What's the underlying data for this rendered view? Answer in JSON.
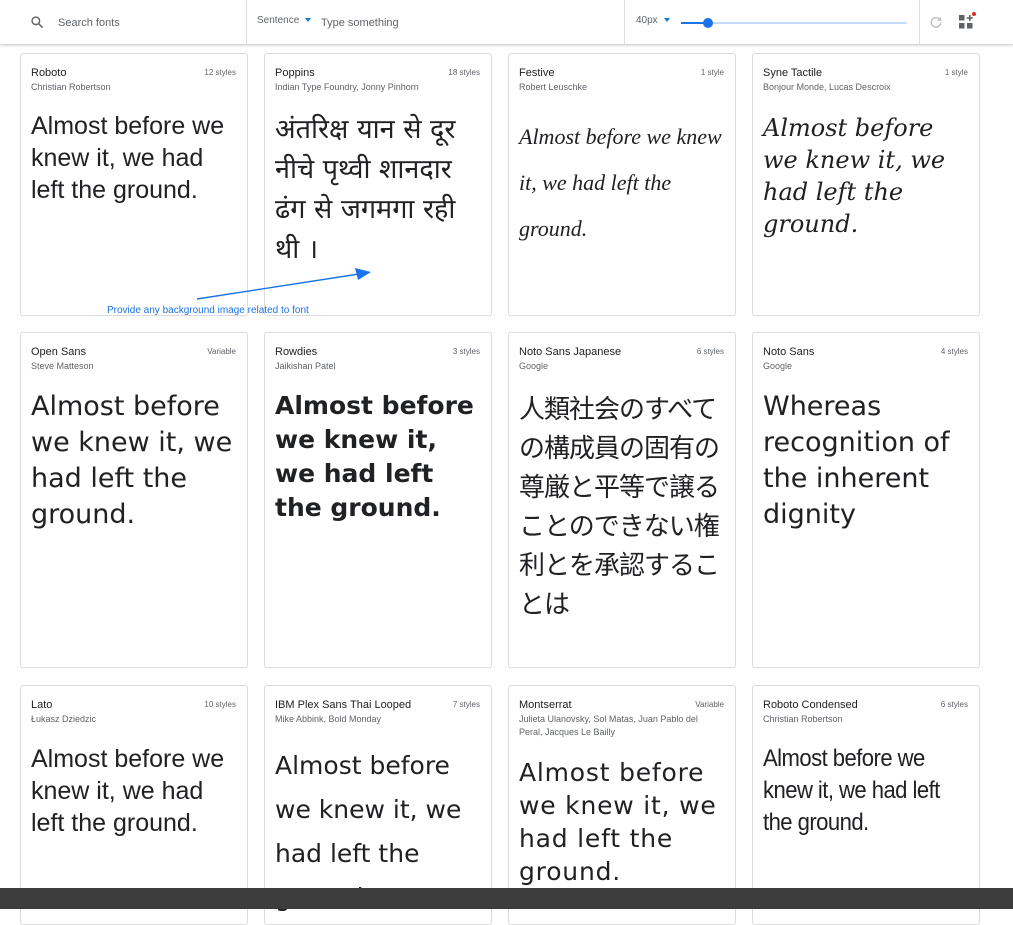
{
  "toolbar": {
    "search_placeholder": "Search fonts",
    "mode_label": "Sentence",
    "text_placeholder": "Type something",
    "size_label": "40px",
    "size_slider_fraction": 0.12
  },
  "annotation": "Provide any background image related to font",
  "fonts": [
    {
      "name": "Roboto",
      "author": "Christian Robertson",
      "styles": "12 styles",
      "sample": "Almost before we knew it, we had left the ground."
    },
    {
      "name": "Poppins",
      "author": "Indian Type Foundry, Jonny Pinhorn",
      "styles": "18 styles",
      "sample": "अंतरिक्ष यान से दूर नीचे पृथ्वी शानदार ढंग से जगमगा रही थी ।"
    },
    {
      "name": "Festive",
      "author": "Robert Leuschke",
      "styles": "1 style",
      "sample": "Almost before we knew it, we had left the ground."
    },
    {
      "name": "Syne Tactile",
      "author": "Bonjour Monde, Lucas Descroix",
      "styles": "1 style",
      "sample": "Almost before we knew it, we had left the ground."
    },
    {
      "name": "Open Sans",
      "author": "Steve Matteson",
      "styles": "Variable",
      "sample": "Almost before we knew it, we had left the ground."
    },
    {
      "name": "Rowdies",
      "author": "Jaikishan Patel",
      "styles": "3 styles",
      "sample": "Almost before we knew it, we had left the ground."
    },
    {
      "name": "Noto Sans Japanese",
      "author": "Google",
      "styles": "6 styles",
      "sample": "人類社会のすべての構成員の固有の尊厳と平等で譲ることのできない権利とを承認することは"
    },
    {
      "name": "Noto Sans",
      "author": "Google",
      "styles": "4 styles",
      "sample": "Whereas recognition of the inherent dignity"
    },
    {
      "name": "Lato",
      "author": "Łukasz Dziedzic",
      "styles": "10 styles",
      "sample": "Almost before we knew it, we had left the ground."
    },
    {
      "name": "IBM Plex Sans Thai Looped",
      "author": "Mike Abbink, Bold Monday",
      "styles": "7 styles",
      "sample": "Almost before we knew it, we had left the ground."
    },
    {
      "name": "Montserrat",
      "author": "Julieta Ulanovsky, Sol Matas, Juan Pablo del Peral, Jacques Le Bailly",
      "styles": "Variable",
      "sample": "Almost before we knew it, we had left the ground."
    },
    {
      "name": "Roboto Condensed",
      "author": "Christian Robertson",
      "styles": "6 styles",
      "sample": "Almost before we knew it, we had left the ground."
    }
  ]
}
